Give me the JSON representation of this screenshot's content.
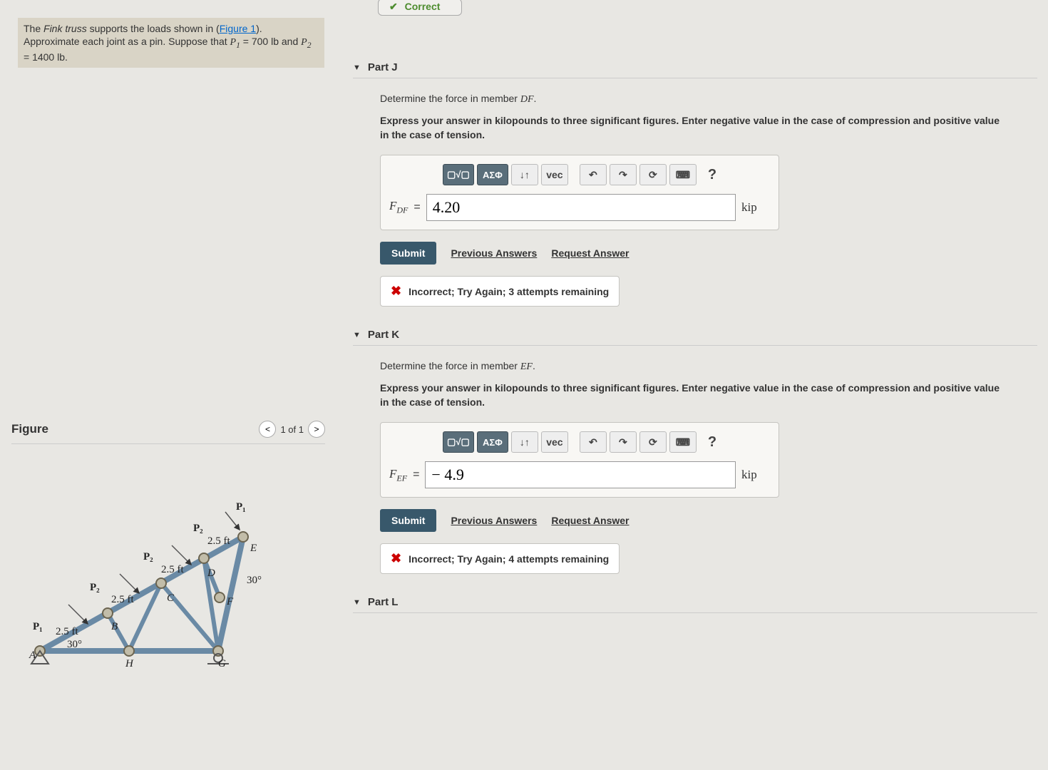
{
  "problem": {
    "html_text_1": "The ",
    "ital1": "Fink truss",
    "html_text_2": " supports the loads shown in (",
    "figure_link": "Figure 1",
    "html_text_3": "). Approximate each joint as a pin. Suppose that ",
    "eq1_var": "P",
    "eq1_sub": "1",
    "eq1_rest": " = 700 lb and ",
    "eq2_var": "P",
    "eq2_sub": "2",
    "eq2_rest": " = 1400 lb."
  },
  "correct_label": "Correct",
  "parts": {
    "J": {
      "title": "Part J",
      "prompt_a": "Determine the force in member ",
      "member": "DF",
      "prompt_b": ".",
      "instruction": "Express your answer in kilopounds to three significant figures. Enter negative value in the case of compression and positive value in the case of tension.",
      "var_letter": "F",
      "var_sub": "DF",
      "value": "4.20",
      "unit": "kip",
      "feedback": "Incorrect; Try Again; 3 attempts remaining"
    },
    "K": {
      "title": "Part K",
      "prompt_a": "Determine the force in member ",
      "member": "EF",
      "prompt_b": ".",
      "instruction": "Express your answer in kilopounds to three significant figures. Enter negative value in the case of compression and positive value in the case of tension.",
      "var_letter": "F",
      "var_sub": "EF",
      "value": "− 4.9",
      "unit": "kip",
      "feedback": "Incorrect; Try Again; 4 attempts remaining"
    },
    "L": {
      "title": "Part L"
    }
  },
  "toolbar": {
    "templates": "▢√▢",
    "greek": "ΑΣΦ",
    "subscript": "↓↑",
    "vec": "vec",
    "undo": "↶",
    "redo": "↷",
    "reset": "⟳",
    "keyboard": "⌨",
    "help": "?"
  },
  "actions": {
    "submit": "Submit",
    "previous": "Previous Answers",
    "request": "Request Answer"
  },
  "figure_panel": {
    "title": "Figure",
    "pager": "1 of 1",
    "labels": {
      "P1": "P₁",
      "P2": "P₂",
      "seg": "2.5 ft",
      "ang30": "30°",
      "A": "A",
      "B": "B",
      "C": "C",
      "D": "D",
      "E": "E",
      "F": "F",
      "G": "G",
      "H": "H"
    }
  }
}
